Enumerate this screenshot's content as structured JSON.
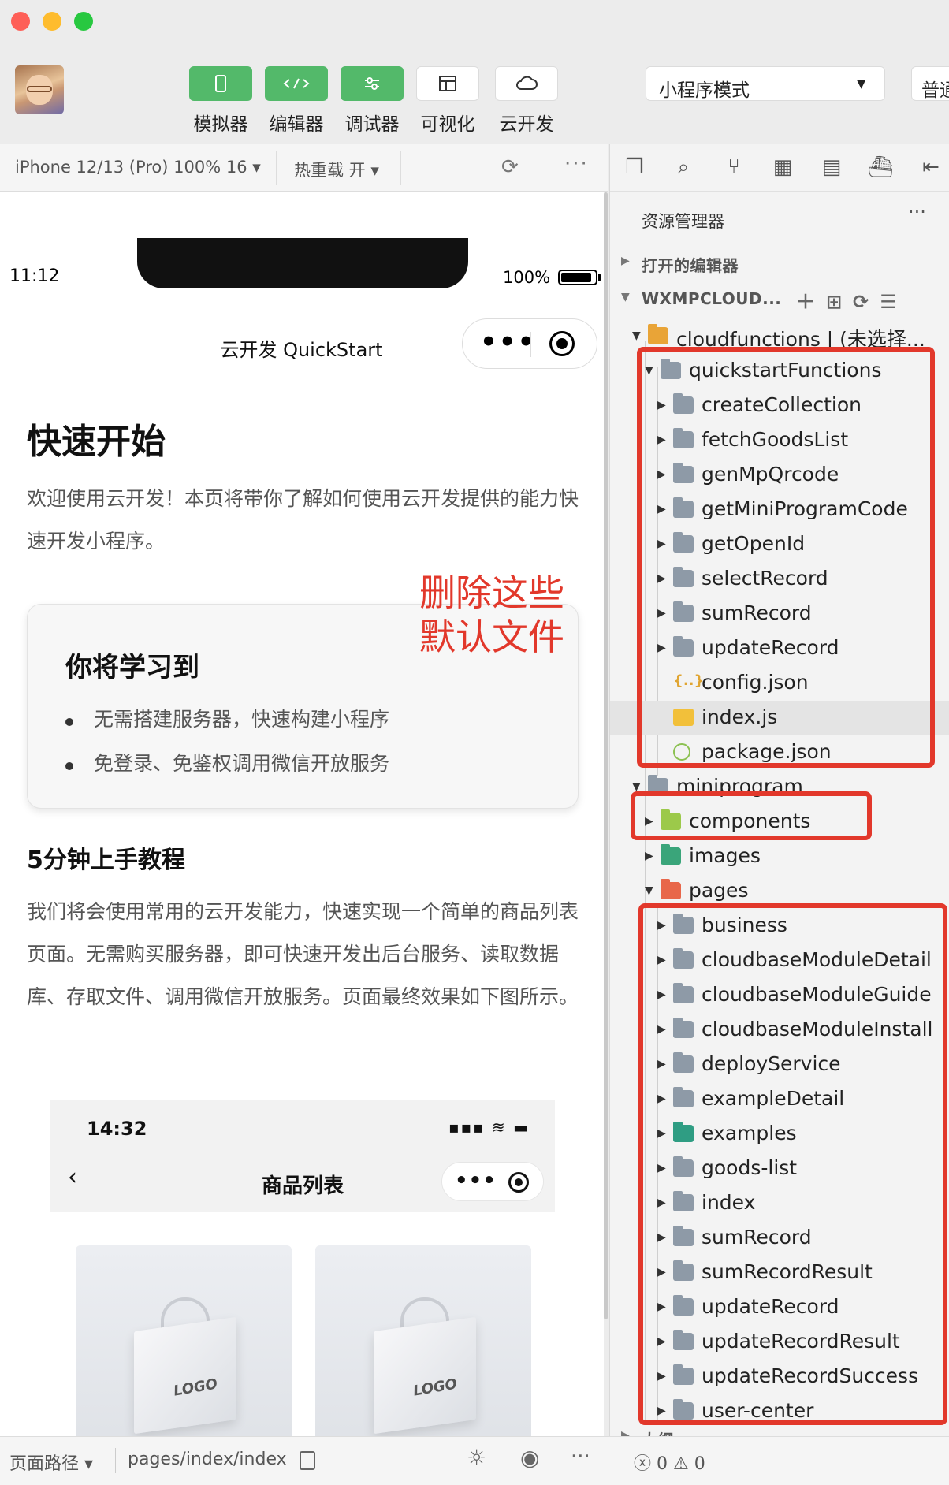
{
  "toolbar": {
    "buttons": [
      {
        "label": "模拟器",
        "icon": "phone-icon"
      },
      {
        "label": "编辑器",
        "icon": "code-icon"
      },
      {
        "label": "调试器",
        "icon": "sliders-icon"
      },
      {
        "label": "可视化",
        "icon": "layout-icon"
      },
      {
        "label": "云开发",
        "icon": "cloud-icon"
      }
    ],
    "mode_select": "小程序模式",
    "right_cut": "普通"
  },
  "simulator_header": {
    "device": "iPhone 12/13 (Pro) 100% 16 ▾",
    "hot_reload": "热重载 开 ▾",
    "more": "···"
  },
  "phone": {
    "time": "11:12",
    "battery": "100%",
    "nav_title": "云开发 QuickStart",
    "heading": "快速开始",
    "intro": "欢迎使用云开发！本页将带你了解如何使用云开发提供的能力快速开发小程序。",
    "learn_title": "你将学习到",
    "learn_items": [
      "无需搭建服务器，快速构建小程序",
      "免登录、免鉴权调用微信开放服务"
    ],
    "annotation": "删除这些\n默认文件",
    "tutorial_title": "5分钟上手教程",
    "tutorial_text": "我们将会使用常用的云开发能力，快速实现一个简单的商品列表页面。无需购买服务器，即可快速开发出后台服务、读取数据库、存取文件、调用微信开放服务。页面最终效果如下图所示。",
    "preview": {
      "time": "14:32",
      "title": "商品列表",
      "status_icons": "▪▪▪ ≋ ▬",
      "back": "‹",
      "logo_text": "LOGO"
    }
  },
  "explorer": {
    "title": "资源管理器",
    "more": "···",
    "open_editors": "打开的编辑器",
    "workspace": "WXMPCLOUD...",
    "outline": "大纲",
    "tree": [
      {
        "label": "cloudfunctions | (未选择...",
        "depth": 0,
        "type": "folder-yellow",
        "open": true
      },
      {
        "label": "quickstartFunctions",
        "depth": 1,
        "type": "folder",
        "open": true
      },
      {
        "label": "createCollection",
        "depth": 2,
        "type": "folder"
      },
      {
        "label": "fetchGoodsList",
        "depth": 2,
        "type": "folder"
      },
      {
        "label": "genMpQrcode",
        "depth": 2,
        "type": "folder"
      },
      {
        "label": "getMiniProgramCode",
        "depth": 2,
        "type": "folder"
      },
      {
        "label": "getOpenId",
        "depth": 2,
        "type": "folder"
      },
      {
        "label": "selectRecord",
        "depth": 2,
        "type": "folder"
      },
      {
        "label": "sumRecord",
        "depth": 2,
        "type": "folder"
      },
      {
        "label": "updateRecord",
        "depth": 2,
        "type": "folder"
      },
      {
        "label": "config.json",
        "depth": 2,
        "type": "json"
      },
      {
        "label": "index.js",
        "depth": 2,
        "type": "js",
        "highlight": true
      },
      {
        "label": "package.json",
        "depth": 2,
        "type": "pkg"
      },
      {
        "label": "miniprogram",
        "depth": 0,
        "type": "folder",
        "open": true
      },
      {
        "label": "components",
        "depth": 1,
        "type": "folder-green"
      },
      {
        "label": "images",
        "depth": 1,
        "type": "folder-teal"
      },
      {
        "label": "pages",
        "depth": 1,
        "type": "folder-orange",
        "open": true
      },
      {
        "label": "business",
        "depth": 2,
        "type": "folder"
      },
      {
        "label": "cloudbaseModuleDetail",
        "depth": 2,
        "type": "folder"
      },
      {
        "label": "cloudbaseModuleGuide",
        "depth": 2,
        "type": "folder"
      },
      {
        "label": "cloudbaseModuleInstall",
        "depth": 2,
        "type": "folder"
      },
      {
        "label": "deployService",
        "depth": 2,
        "type": "folder"
      },
      {
        "label": "exampleDetail",
        "depth": 2,
        "type": "folder"
      },
      {
        "label": "examples",
        "depth": 2,
        "type": "folder-teal2"
      },
      {
        "label": "goods-list",
        "depth": 2,
        "type": "folder"
      },
      {
        "label": "index",
        "depth": 2,
        "type": "folder"
      },
      {
        "label": "sumRecord",
        "depth": 2,
        "type": "folder"
      },
      {
        "label": "sumRecordResult",
        "depth": 2,
        "type": "folder"
      },
      {
        "label": "updateRecord",
        "depth": 2,
        "type": "folder"
      },
      {
        "label": "updateRecordResult",
        "depth": 2,
        "type": "folder"
      },
      {
        "label": "updateRecordSuccess",
        "depth": 2,
        "type": "folder"
      },
      {
        "label": "user-center",
        "depth": 2,
        "type": "folder"
      }
    ]
  },
  "statusbar": {
    "path_label": "页面路径 ▾",
    "path": "pages/index/index",
    "errors": "ⓧ 0 ⚠ 0"
  },
  "colors": {
    "accent_green": "#53b96a",
    "annotation_red": "#e2382b"
  }
}
